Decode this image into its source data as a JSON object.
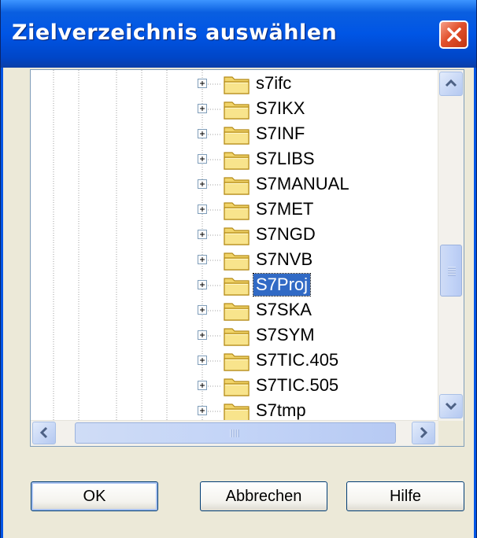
{
  "window": {
    "title": "Zielverzeichnis auswählen",
    "close_icon": "close-icon"
  },
  "tree": {
    "items": [
      {
        "label": "s7ifc",
        "selected": false
      },
      {
        "label": "S7IKX",
        "selected": false
      },
      {
        "label": "S7INF",
        "selected": false
      },
      {
        "label": "S7LIBS",
        "selected": false
      },
      {
        "label": "S7MANUAL",
        "selected": false
      },
      {
        "label": "S7MET",
        "selected": false
      },
      {
        "label": "S7NGD",
        "selected": false
      },
      {
        "label": "S7NVB",
        "selected": false
      },
      {
        "label": "S7Proj",
        "selected": true
      },
      {
        "label": "S7SKA",
        "selected": false
      },
      {
        "label": "S7SYM",
        "selected": false
      },
      {
        "label": "S7TIC.405",
        "selected": false
      },
      {
        "label": "S7TIC.505",
        "selected": false
      },
      {
        "label": "S7tmp",
        "selected": false
      }
    ]
  },
  "buttons": {
    "ok": "OK",
    "cancel": "Abbrechen",
    "help": "Hilfe"
  },
  "colors": {
    "titlebar": "#0055e5",
    "selection": "#316ac5",
    "close": "#e2512d"
  }
}
